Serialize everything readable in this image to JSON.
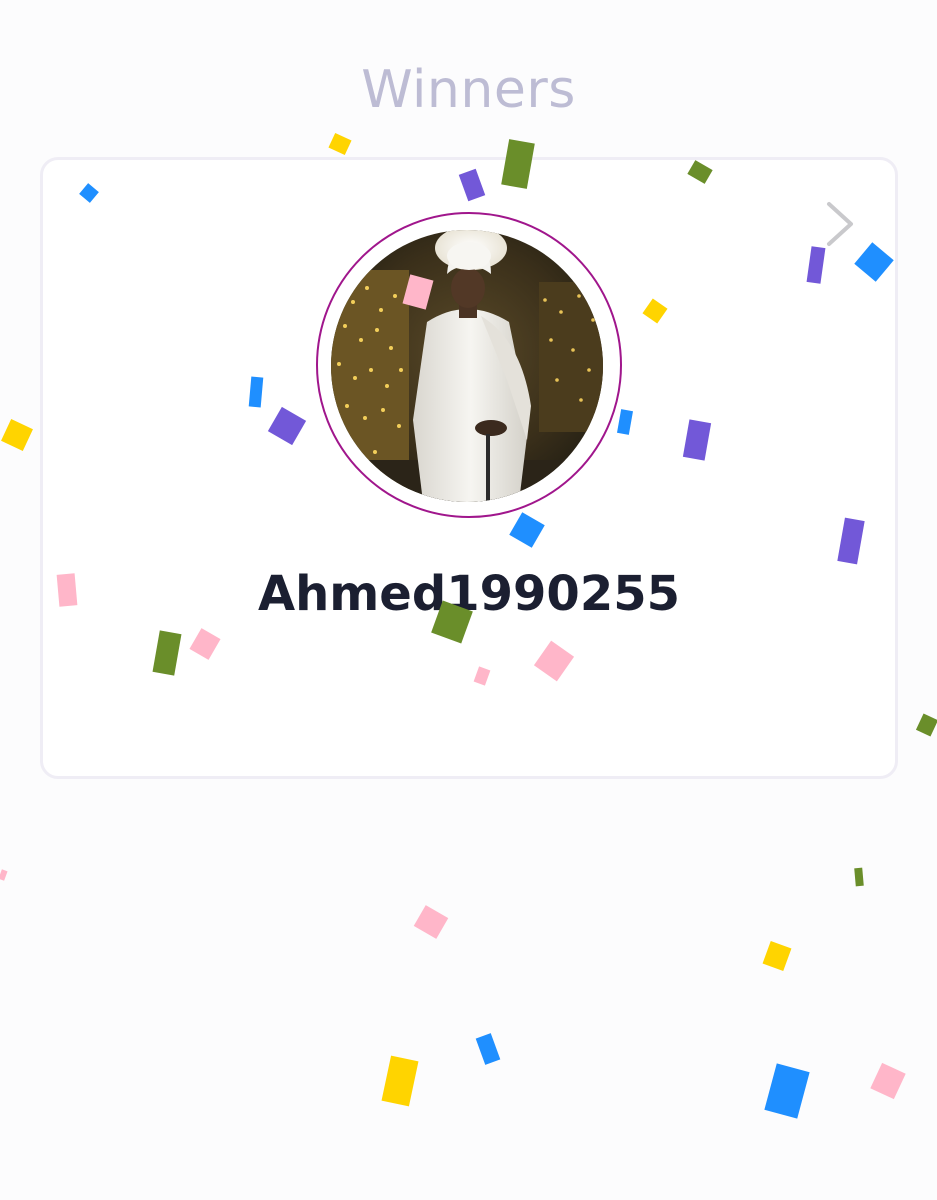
{
  "header": {
    "title": "Winners"
  },
  "winner_card": {
    "username": "Ahmed1990255",
    "avatar_icon": "winner-profile-photo",
    "ring_color": "#a0168c",
    "next_icon": "chevron-right-icon"
  },
  "confetti_colors": {
    "yellow": "#ffd400",
    "green": "#6a8e2a",
    "purple": "#7258d8",
    "blue": "#1f8fff",
    "pink": "#ffb6c9"
  }
}
